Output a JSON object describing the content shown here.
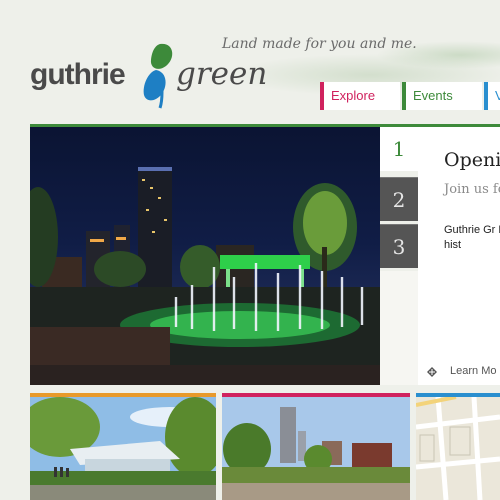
{
  "header": {
    "logo_text_left": "guthrie",
    "logo_text_right": "green",
    "tagline": "Land made for you and me."
  },
  "nav": {
    "items": [
      {
        "label": "Explore",
        "color": "#d0225e"
      },
      {
        "label": "Events",
        "color": "#3d8a3a"
      },
      {
        "label": "V",
        "color": "#2a8fcf"
      }
    ]
  },
  "slider": {
    "tabs": [
      "1",
      "2",
      "3"
    ],
    "active_index": 0,
    "title": "Openi",
    "subtitle": "Join us fo Tulsa.",
    "body": "Guthrie Gr District. Ed fountains, to this hist",
    "learn_more": "Learn Mo"
  },
  "colors": {
    "brand_green": "#3d8a3a",
    "brand_blue": "#1e7fc4",
    "accent_orange": "#e89a2a",
    "accent_pink": "#d0225e",
    "accent_blue": "#2a8fcf"
  }
}
